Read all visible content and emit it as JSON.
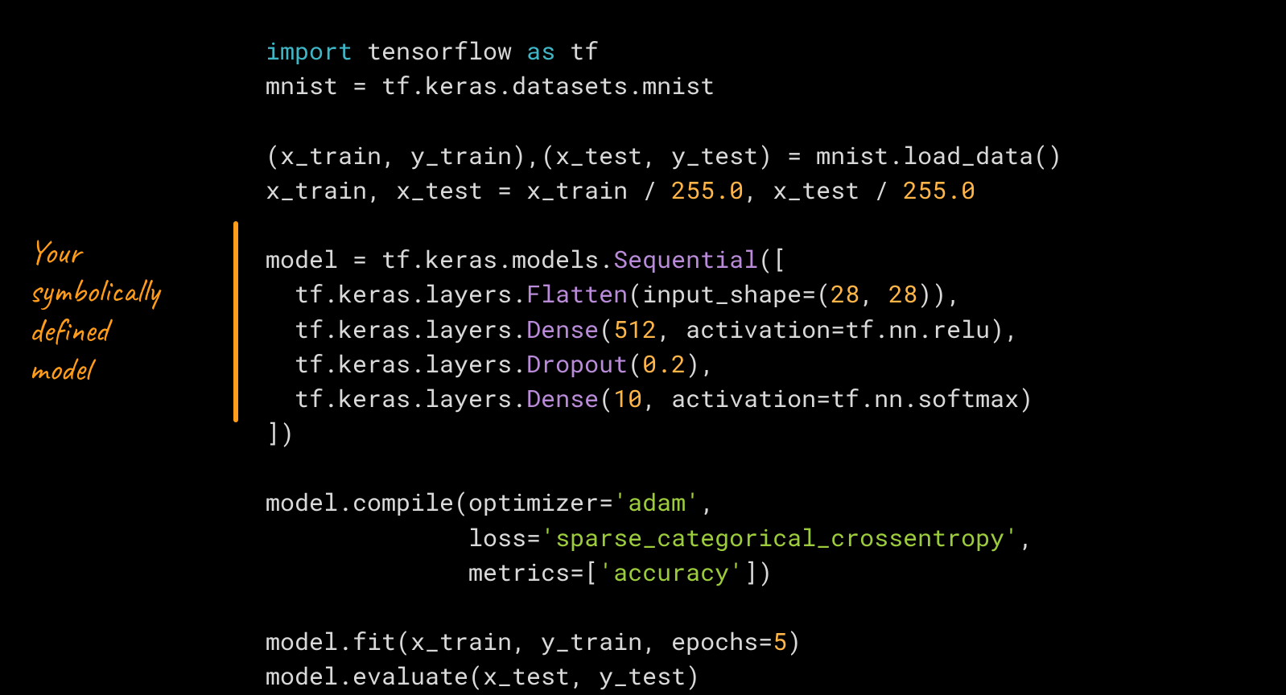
{
  "colors": {
    "default": "#d9d9d9",
    "keyword": "#3fb6c6",
    "classname": "#b98bd9",
    "number": "#ffb547",
    "string": "#9ccc3c",
    "annotation": "#ff9d1b"
  },
  "annotation": {
    "line1": "Your",
    "line2": "symbolically",
    "line3": "defined",
    "line4": "model"
  },
  "code_lines": [
    [
      {
        "t": "import",
        "c": "keyword"
      },
      {
        "t": " tensorflow ",
        "c": "default"
      },
      {
        "t": "as",
        "c": "keyword"
      },
      {
        "t": " tf",
        "c": "default"
      }
    ],
    [
      {
        "t": "mnist = tf.keras.datasets.mnist",
        "c": "default"
      }
    ],
    [],
    [
      {
        "t": "(x_train, y_train),(x_test, y_test) = mnist.load_data()",
        "c": "default"
      }
    ],
    [
      {
        "t": "x_train, x_test = x_train / ",
        "c": "default"
      },
      {
        "t": "255.0",
        "c": "number"
      },
      {
        "t": ", x_test / ",
        "c": "default"
      },
      {
        "t": "255.0",
        "c": "number"
      }
    ],
    [],
    [
      {
        "t": "model = tf.keras.models.",
        "c": "default"
      },
      {
        "t": "Sequential",
        "c": "classname"
      },
      {
        "t": "([",
        "c": "default"
      }
    ],
    [
      {
        "t": "  tf.keras.layers.",
        "c": "default"
      },
      {
        "t": "Flatten",
        "c": "classname"
      },
      {
        "t": "(input_shape=(",
        "c": "default"
      },
      {
        "t": "28",
        "c": "number"
      },
      {
        "t": ", ",
        "c": "default"
      },
      {
        "t": "28",
        "c": "number"
      },
      {
        "t": ")),",
        "c": "default"
      }
    ],
    [
      {
        "t": "  tf.keras.layers.",
        "c": "default"
      },
      {
        "t": "Dense",
        "c": "classname"
      },
      {
        "t": "(",
        "c": "default"
      },
      {
        "t": "512",
        "c": "number"
      },
      {
        "t": ", activation=tf.nn.relu),",
        "c": "default"
      }
    ],
    [
      {
        "t": "  tf.keras.layers.",
        "c": "default"
      },
      {
        "t": "Dropout",
        "c": "classname"
      },
      {
        "t": "(",
        "c": "default"
      },
      {
        "t": "0.2",
        "c": "number"
      },
      {
        "t": "),",
        "c": "default"
      }
    ],
    [
      {
        "t": "  tf.keras.layers.",
        "c": "default"
      },
      {
        "t": "Dense",
        "c": "classname"
      },
      {
        "t": "(",
        "c": "default"
      },
      {
        "t": "10",
        "c": "number"
      },
      {
        "t": ", activation=tf.nn.softmax)",
        "c": "default"
      }
    ],
    [
      {
        "t": "])",
        "c": "default"
      }
    ],
    [],
    [
      {
        "t": "model.compile(optimizer=",
        "c": "default"
      },
      {
        "t": "'adam'",
        "c": "string"
      },
      {
        "t": ",",
        "c": "default"
      }
    ],
    [
      {
        "t": "              loss=",
        "c": "default"
      },
      {
        "t": "'sparse_categorical_crossentropy'",
        "c": "string"
      },
      {
        "t": ",",
        "c": "default"
      }
    ],
    [
      {
        "t": "              metrics=[",
        "c": "default"
      },
      {
        "t": "'accuracy'",
        "c": "string"
      },
      {
        "t": "])",
        "c": "default"
      }
    ],
    [],
    [
      {
        "t": "model.fit(x_train, y_train, epochs=",
        "c": "default"
      },
      {
        "t": "5",
        "c": "number"
      },
      {
        "t": ")",
        "c": "default"
      }
    ],
    [
      {
        "t": "model.evaluate(x_test, y_test)",
        "c": "default"
      }
    ]
  ]
}
